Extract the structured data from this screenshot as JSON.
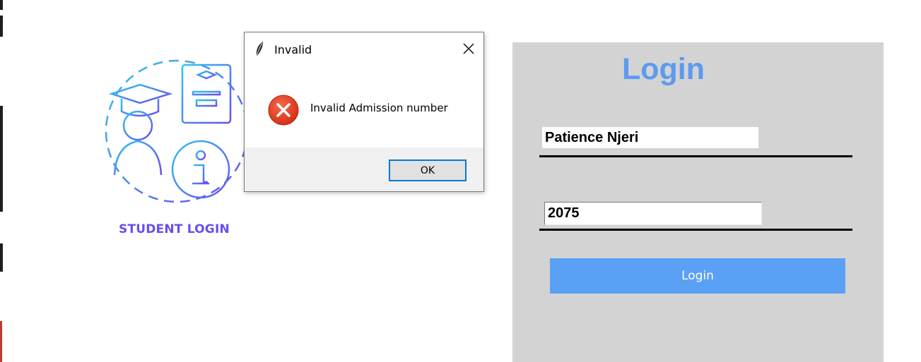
{
  "illustration": {
    "caption": "STUDENT LOGIN"
  },
  "login_panel": {
    "title": "Login",
    "name_value": "Patience Njeri",
    "admission_value": "2075",
    "button_label": "Login"
  },
  "dialog": {
    "title": "Invalid",
    "message": "Invalid Admission number",
    "ok_label": "OK",
    "icon": "error-icon"
  },
  "colors": {
    "panel_bg": "#d3d3d3",
    "title_blue": "#5b9bf0",
    "button_blue": "#5aa1f5",
    "caption_purple": "#6a4cf0",
    "error_red": "#e8401c"
  }
}
